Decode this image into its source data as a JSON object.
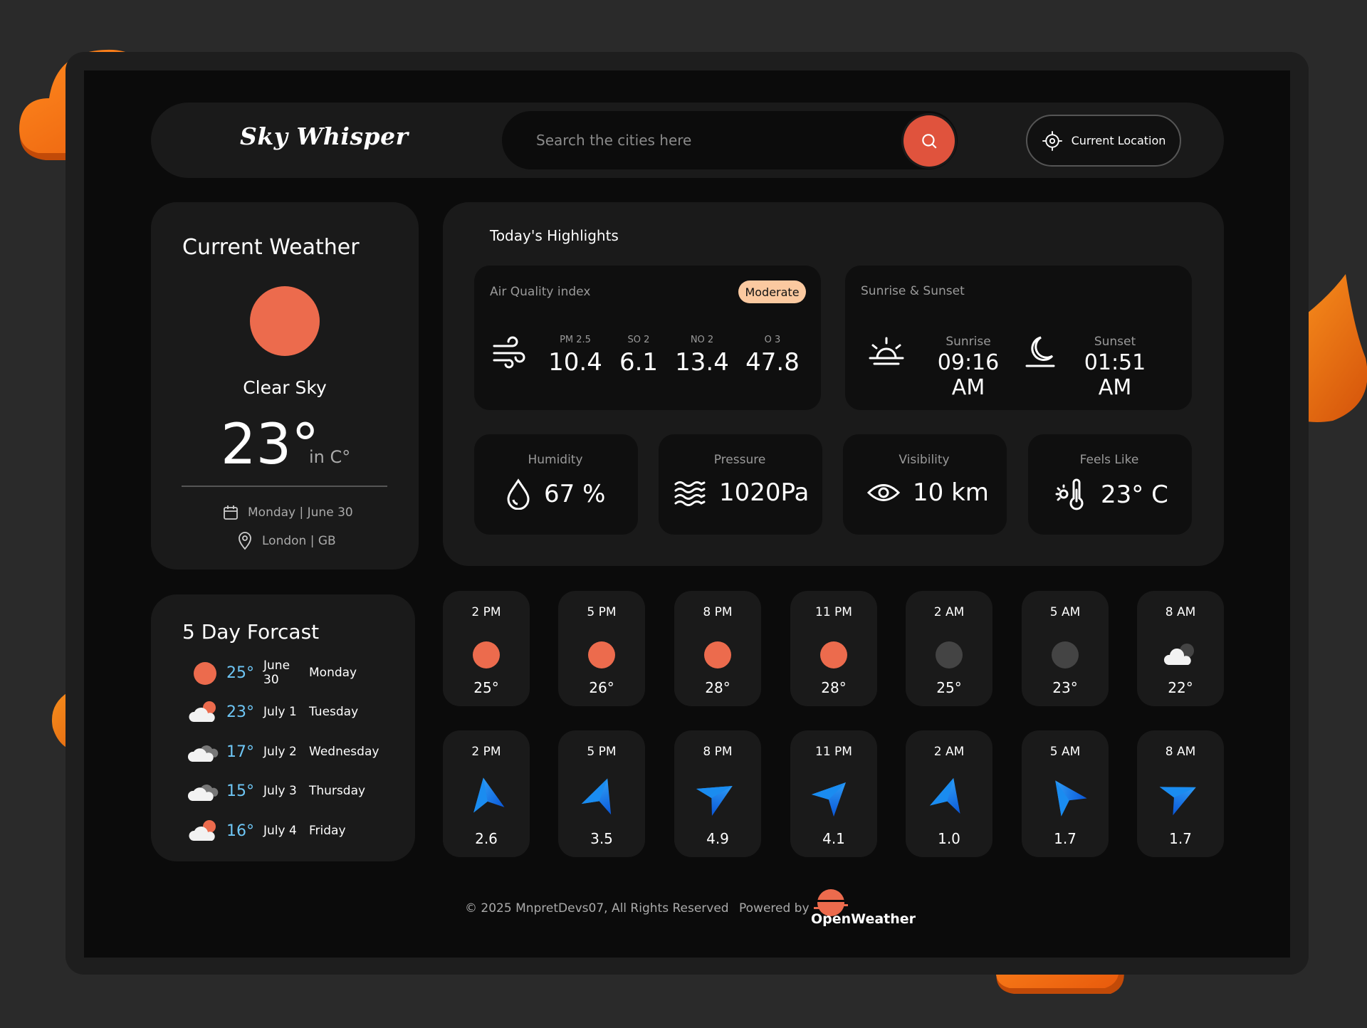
{
  "app": {
    "title": "Sky Whisper",
    "accent": "#e0533d"
  },
  "search": {
    "placeholder": "Search the cities here"
  },
  "location_button": {
    "label": "Current Location"
  },
  "current": {
    "title": "Current Weather",
    "condition": "Clear Sky",
    "temp": "23°",
    "unit": "in C°",
    "date": "Monday | June 30",
    "location": "London | GB"
  },
  "highlights": {
    "title": "Today's Highlights",
    "air_quality": {
      "label": "Air Quality index",
      "badge": "Moderate",
      "items": [
        {
          "key": "PM 2.5",
          "value": "10.4"
        },
        {
          "key": "SO 2",
          "value": "6.1"
        },
        {
          "key": "NO 2",
          "value": "13.4"
        },
        {
          "key": "O 3",
          "value": "47.8"
        }
      ]
    },
    "sun": {
      "label": "Sunrise & Sunset",
      "sunrise_label": "Sunrise",
      "sunrise": "09:16 AM",
      "sunset_label": "Sunset",
      "sunset": "01:51 AM"
    },
    "humidity": {
      "label": "Humidity",
      "value": "67 %"
    },
    "pressure": {
      "label": "Pressure",
      "value": "1020Pa"
    },
    "visibility": {
      "label": "Visibility",
      "value": "10 km"
    },
    "feels_like": {
      "label": "Feels Like",
      "value": "23° C"
    }
  },
  "forecast": {
    "title": "5 Day Forcast",
    "days": [
      {
        "icon": "sun-icon",
        "temp": "25°",
        "date": "June 30",
        "day": "Monday"
      },
      {
        "icon": "cloud-sun-icon",
        "temp": "23°",
        "date": "July 1",
        "day": "Tuesday"
      },
      {
        "icon": "clouds-icon",
        "temp": "17°",
        "date": "July 2",
        "day": "Wednesday"
      },
      {
        "icon": "clouds-icon",
        "temp": "15°",
        "date": "July 3",
        "day": "Thursday"
      },
      {
        "icon": "cloud-sun-icon",
        "temp": "16°",
        "date": "July 4",
        "day": "Friday"
      }
    ]
  },
  "hourly_temp": [
    {
      "time": "2 PM",
      "icon": "sun-icon",
      "temp": "25°"
    },
    {
      "time": "5 PM",
      "icon": "sun-icon",
      "temp": "26°"
    },
    {
      "time": "8 PM",
      "icon": "sun-icon",
      "temp": "28°"
    },
    {
      "time": "11 PM",
      "icon": "sun-icon",
      "temp": "28°"
    },
    {
      "time": "2 AM",
      "icon": "moon-icon",
      "temp": "25°"
    },
    {
      "time": "5 AM",
      "icon": "moon-icon",
      "temp": "23°"
    },
    {
      "time": "8 AM",
      "icon": "cloud-moon-icon",
      "temp": "22°"
    }
  ],
  "hourly_wind": [
    {
      "time": "2 PM",
      "icon": "wind-direction-icon",
      "speed": "2.6"
    },
    {
      "time": "5 PM",
      "icon": "wind-direction-icon",
      "speed": "3.5"
    },
    {
      "time": "8 PM",
      "icon": "wind-direction-icon",
      "speed": "4.9"
    },
    {
      "time": "11 PM",
      "icon": "wind-direction-icon",
      "speed": "4.1"
    },
    {
      "time": "2 AM",
      "icon": "wind-direction-icon",
      "speed": "1.0"
    },
    {
      "time": "5 AM",
      "icon": "wind-direction-icon",
      "speed": "1.7"
    },
    {
      "time": "8 AM",
      "icon": "wind-direction-icon",
      "speed": "1.7"
    }
  ],
  "footer": {
    "copyright": "© 2025 MnpretDevs07, All Rights Reserved",
    "powered": "Powered by",
    "brand": "OpenWeather"
  }
}
